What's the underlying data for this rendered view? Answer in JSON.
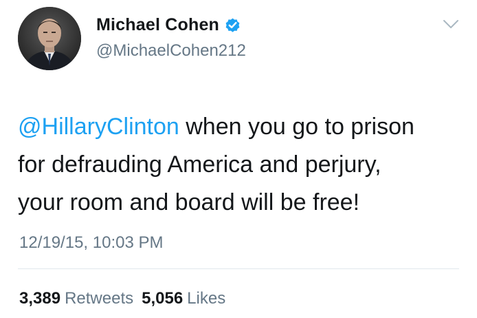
{
  "author": {
    "name": "Michael Cohen",
    "handle": "@MichaelCohen212",
    "avatar_icon": "profile-photo",
    "verified_icon": "verified-badge-icon"
  },
  "tweet": {
    "mention": "@HillaryClinton",
    "text_line1_rest": " when you go to prison",
    "text_line2": "for defrauding America and perjury,",
    "text_line3": "your room and board will be free!",
    "timestamp": "12/19/15, 10:03 PM"
  },
  "stats": {
    "retweets_count": "3,389",
    "retweets_label": "Retweets",
    "likes_count": "5,056",
    "likes_label": "Likes"
  },
  "colors": {
    "accent": "#1da1f2",
    "text": "#14171a",
    "muted": "#657786"
  }
}
